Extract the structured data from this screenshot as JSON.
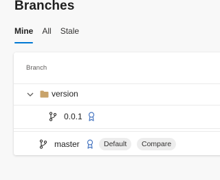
{
  "page": {
    "title": "Branches"
  },
  "tabs": [
    {
      "label": "Mine",
      "selected": true
    },
    {
      "label": "All",
      "selected": false
    },
    {
      "label": "Stale",
      "selected": false
    }
  ],
  "table": {
    "column_header": "Branch",
    "folder": {
      "name": "version",
      "expanded": true,
      "icon": "folder-icon"
    },
    "rows": [
      {
        "name": "0.0.1",
        "icon": "branch-icon",
        "policy_icon": "ribbon-icon"
      },
      {
        "name": "master",
        "icon": "branch-icon",
        "policy_icon": "ribbon-icon",
        "default_badge": "Default",
        "compare_label": "Compare"
      }
    ]
  },
  "colors": {
    "accent": "#0078d4",
    "folder": "#c8a36b",
    "ribbon": "#4a78c2"
  }
}
